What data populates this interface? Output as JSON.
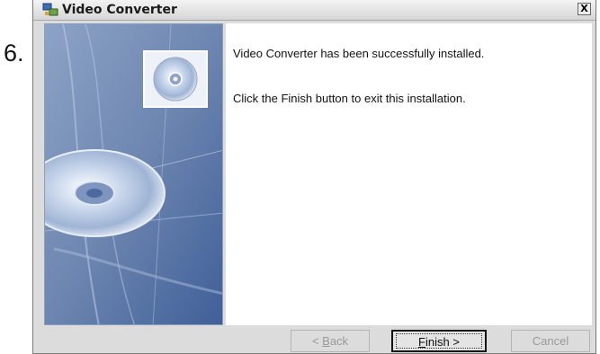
{
  "step_number": "6.",
  "window": {
    "title": "Video Converter",
    "close_label": "X",
    "app_icon": "computer-network-icon"
  },
  "content": {
    "message_installed": "Video Converter has been successfully installed.",
    "message_finish": "Click the Finish button to exit this installation."
  },
  "buttons": {
    "back_hotkey": "B",
    "back_rest": "ack",
    "back_prefix": "< ",
    "finish_hotkey": "F",
    "finish_rest": "inish >",
    "cancel_label": "Cancel"
  },
  "side_panel_icon": "cd-disc-icon",
  "colors": {
    "dialog_bg": "#dcdcdc",
    "art_blue": "#6b86b3",
    "content_bg": "#ffffff"
  }
}
